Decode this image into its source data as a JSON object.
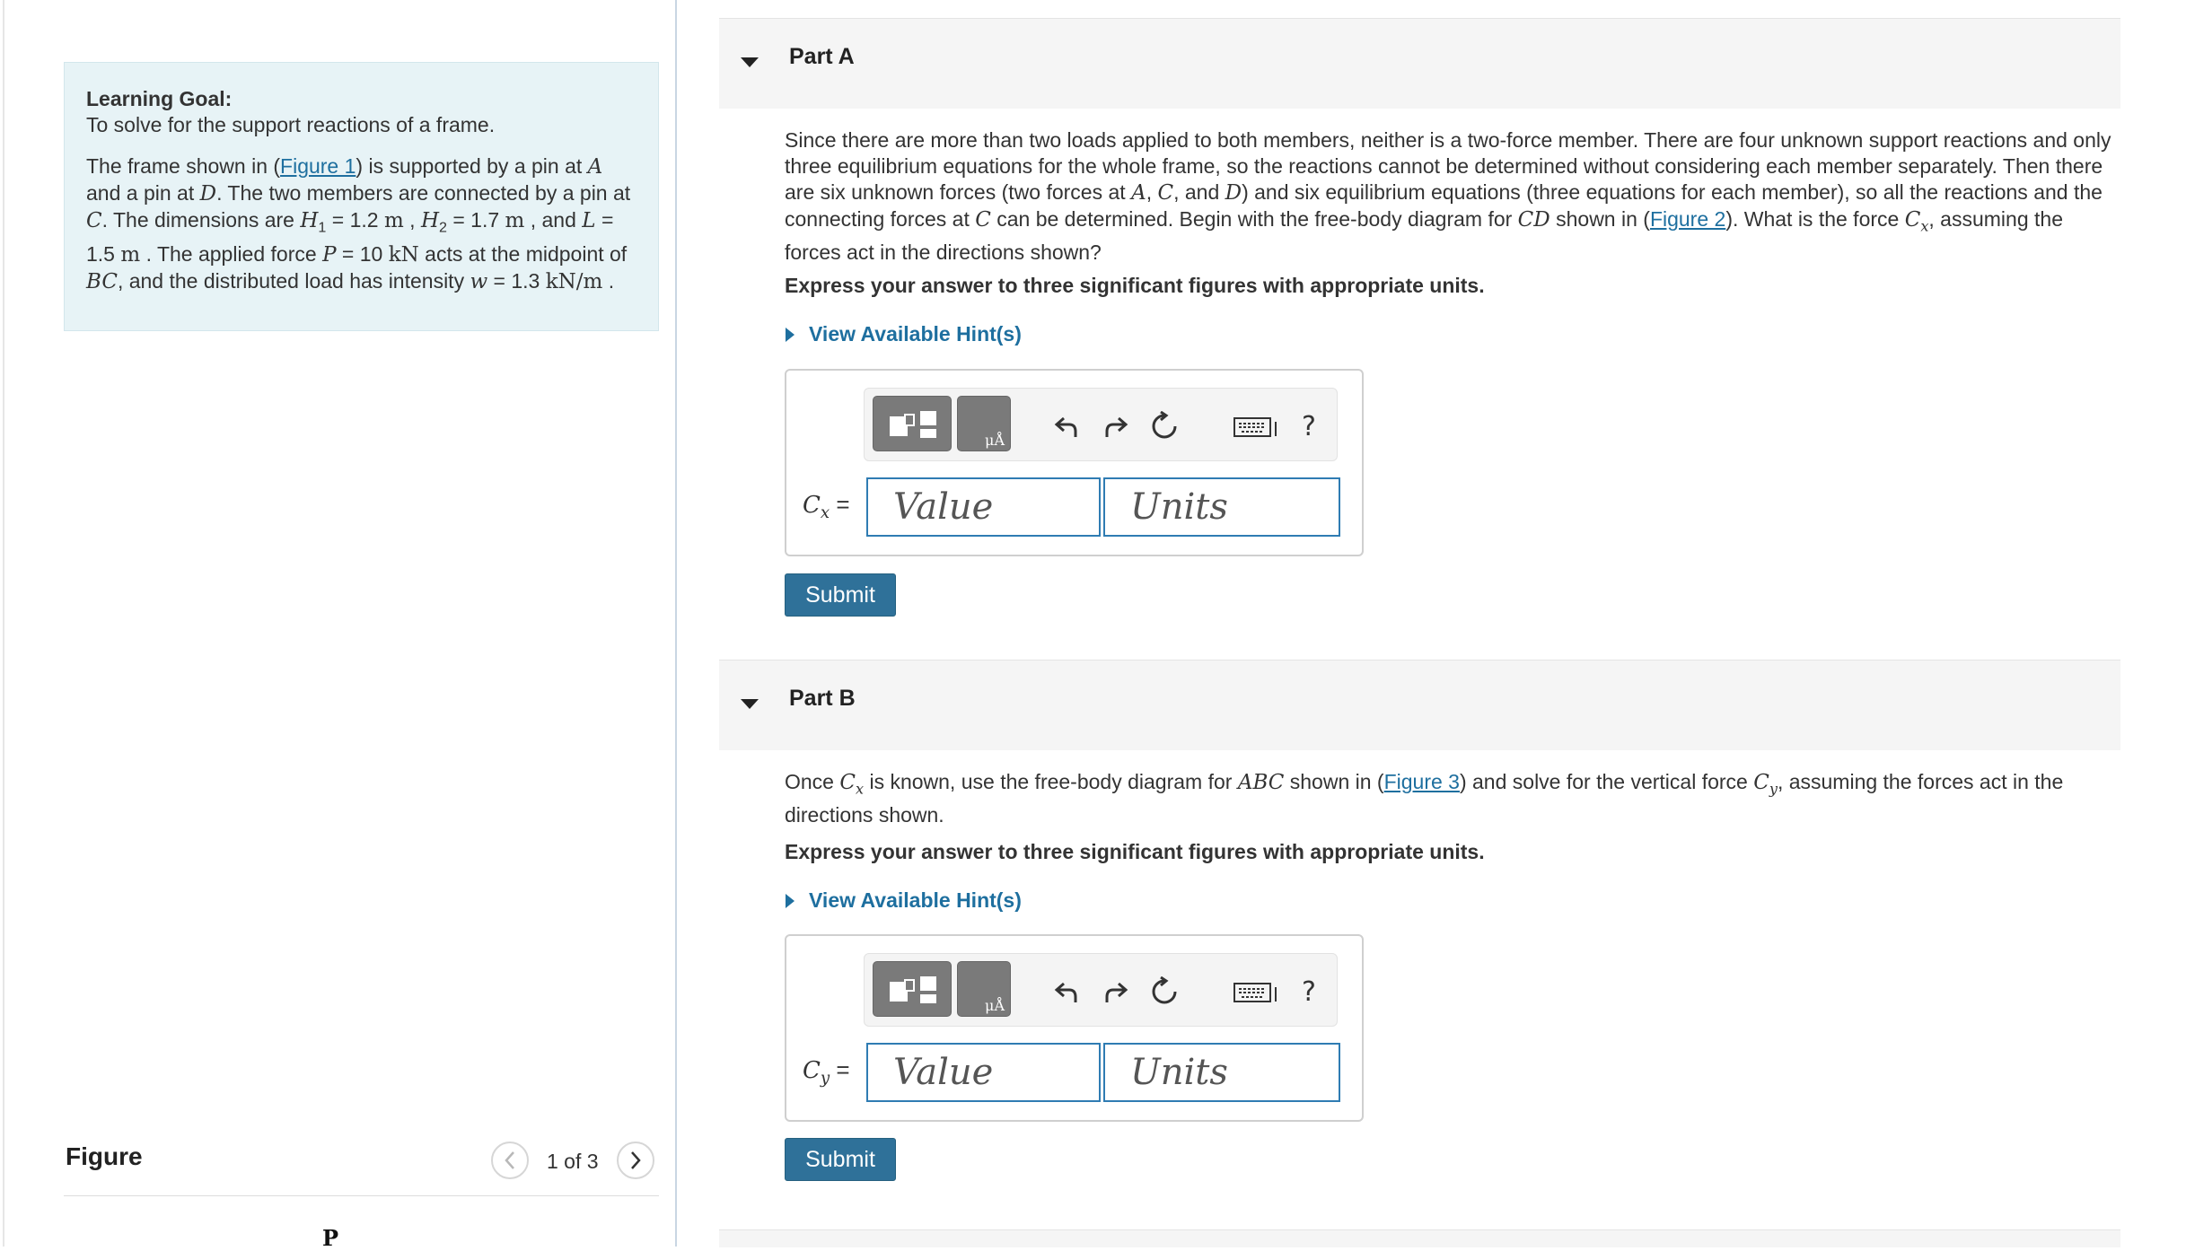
{
  "learning_goal": {
    "title": "Learning Goal:",
    "subtitle": "To solve for the support reactions of a frame.",
    "t1": "The frame shown in (",
    "figure_link": "Figure 1",
    "t2": ") is supported by a pin at ",
    "A": "A",
    "t3": " and a pin at ",
    "D": "D",
    "t4": ". The two members are connected by a pin at ",
    "C": "C",
    "t5": ". The dimensions are ",
    "H1_sym": "H",
    "H1_sub": "1",
    "H1_val": " = 1.2 ",
    "m1": "m",
    "t6": " , ",
    "H2_sym": "H",
    "H2_sub": "2",
    "H2_val": " = 1.7 ",
    "m2": "m",
    "t7": " , and ",
    "L_sym": "L",
    "L_val": " = 1.5 ",
    "m3": "m",
    "t8": " . The applied force ",
    "P_sym": "P",
    "P_val": " = 10 ",
    "kN": "kN",
    "t9": " acts at the midpoint of ",
    "BC": "BC",
    "t10": ", and the distributed load has intensity ",
    "w_sym": "w",
    "t11": " = 1.3 ",
    "kNm": "kN/m",
    "t12": " ."
  },
  "figure_panel": {
    "title": "Figure",
    "page_indicator": "1 of 3",
    "prev_icon": "chevron-left-icon",
    "next_icon": "chevron-right-icon",
    "label_p": "P"
  },
  "part_a": {
    "title": "Part A",
    "prompt": {
      "t1": "Since there are more than two loads applied to both members, neither is a two-force member. There are four unknown support reactions and only three equilibrium equations for the whole frame, so the reactions cannot be determined without considering each member separately. Then there are six unknown forces (two forces at ",
      "A": "A",
      "c1": ", ",
      "C": "C",
      "c2": ", and ",
      "D": "D",
      "t2": ") and six equilibrium equations (three equations for each member), so all the reactions and the connecting forces at ",
      "C2": "C",
      "t3": " can be determined. Begin with the free-body diagram for ",
      "CD": "CD",
      "t4": " shown in (",
      "figure_link": "Figure 2",
      "t5": "). What is the force ",
      "Cx_sym": "C",
      "Cx_sub": "x",
      "t6": ", assuming the forces act in the directions shown?"
    },
    "instruction": "Express your answer to three significant figures with appropriate units.",
    "hint": "View Available Hint(s)",
    "var_sym": "C",
    "var_sub": "x",
    "var_eq": " =",
    "value_placeholder": "Value",
    "units_placeholder": "Units",
    "submit": "Submit"
  },
  "part_b": {
    "title": "Part B",
    "prompt": {
      "t1": "Once ",
      "Cx_sym": "C",
      "Cx_sub": "x",
      "t2": " is known, use the free-body diagram for ",
      "ABC": "ABC",
      "t3": " shown in (",
      "figure_link": "Figure 3",
      "t4": ") and solve for the vertical force ",
      "Cy_sym": "C",
      "Cy_sub": "y",
      "t5": ", assuming the forces act in the directions shown."
    },
    "instruction": "Express your answer to three significant figures with appropriate units.",
    "hint": "View Available Hint(s)",
    "var_sym": "C",
    "var_sub": "y",
    "var_eq": " =",
    "value_placeholder": "Value",
    "units_placeholder": "Units",
    "submit": "Submit"
  },
  "toolbar": {
    "template_icon": "templates-icon",
    "symbols_icon": "symbols-icon",
    "symbols_label": "μÅ",
    "undo_icon": "undo-icon",
    "redo_icon": "redo-icon",
    "reset_icon": "reset-icon",
    "keyboard_icon": "keyboard-icon",
    "help_label": "?"
  },
  "colors": {
    "link": "#1e6f9f",
    "goal_bg": "#e7f3f6",
    "submit_bg": "#2f7199",
    "input_border": "#2f7cb3"
  }
}
